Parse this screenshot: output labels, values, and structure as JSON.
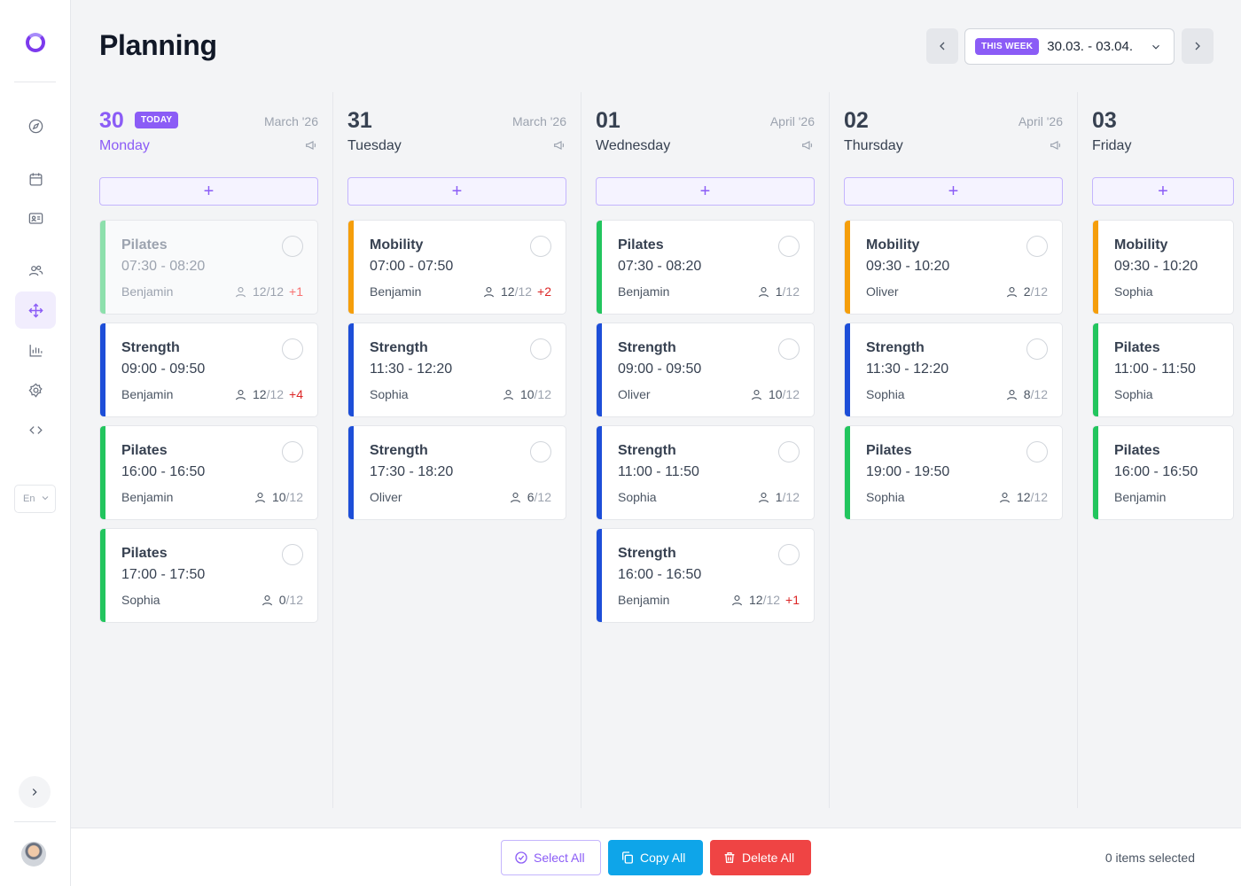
{
  "sidebar": {
    "nav_icons": [
      "compass-icon",
      "calendar-icon",
      "contact-card-icon",
      "users-icon",
      "move-arrows-icon",
      "bar-chart-icon",
      "gear-icon",
      "code-icon"
    ],
    "active_icon": "move-arrows-icon",
    "language": "En",
    "accent_color": "#8b5cf6"
  },
  "header": {
    "title": "Planning",
    "week_badge": "THIS WEEK",
    "week_range": "30.03. - 03.04."
  },
  "days": [
    {
      "num": "30",
      "weekday": "Monday",
      "month": "March '26",
      "today": true,
      "today_label": "TODAY",
      "classes": [
        {
          "title": "Pilates",
          "time": "07:30 - 08:20",
          "coach": "Benjamin",
          "booked": "12",
          "cap": "/12",
          "extra": "+1",
          "color": "#22c55e",
          "faded": true
        },
        {
          "title": "Strength",
          "time": "09:00 - 09:50",
          "coach": "Benjamin",
          "booked": "12",
          "cap": "/12",
          "extra": "+4",
          "color": "#1d4ed8",
          "faded": false
        },
        {
          "title": "Pilates",
          "time": "16:00 - 16:50",
          "coach": "Benjamin",
          "booked": "10",
          "cap": "/12",
          "extra": "",
          "color": "#22c55e",
          "faded": false
        },
        {
          "title": "Pilates",
          "time": "17:00 - 17:50",
          "coach": "Sophia",
          "booked": "0",
          "cap": "/12",
          "extra": "",
          "color": "#22c55e",
          "faded": false
        }
      ]
    },
    {
      "num": "31",
      "weekday": "Tuesday",
      "month": "March '26",
      "today": false,
      "classes": [
        {
          "title": "Mobility",
          "time": "07:00 - 07:50",
          "coach": "Benjamin",
          "booked": "12",
          "cap": "/12",
          "extra": "+2",
          "color": "#f59e0b",
          "faded": false
        },
        {
          "title": "Strength",
          "time": "11:30 - 12:20",
          "coach": "Sophia",
          "booked": "10",
          "cap": "/12",
          "extra": "",
          "color": "#1d4ed8",
          "faded": false
        },
        {
          "title": "Strength",
          "time": "17:30 - 18:20",
          "coach": "Oliver",
          "booked": "6",
          "cap": "/12",
          "extra": "",
          "color": "#1d4ed8",
          "faded": false
        }
      ]
    },
    {
      "num": "01",
      "weekday": "Wednesday",
      "month": "April '26",
      "today": false,
      "classes": [
        {
          "title": "Pilates",
          "time": "07:30 - 08:20",
          "coach": "Benjamin",
          "booked": "1",
          "cap": "/12",
          "extra": "",
          "color": "#22c55e",
          "faded": false
        },
        {
          "title": "Strength",
          "time": "09:00 - 09:50",
          "coach": "Oliver",
          "booked": "10",
          "cap": "/12",
          "extra": "",
          "color": "#1d4ed8",
          "faded": false
        },
        {
          "title": "Strength",
          "time": "11:00 - 11:50",
          "coach": "Sophia",
          "booked": "1",
          "cap": "/12",
          "extra": "",
          "color": "#1d4ed8",
          "faded": false
        },
        {
          "title": "Strength",
          "time": "16:00 - 16:50",
          "coach": "Benjamin",
          "booked": "12",
          "cap": "/12",
          "extra": "+1",
          "color": "#1d4ed8",
          "faded": false
        }
      ]
    },
    {
      "num": "02",
      "weekday": "Thursday",
      "month": "April '26",
      "today": false,
      "classes": [
        {
          "title": "Mobility",
          "time": "09:30 - 10:20",
          "coach": "Oliver",
          "booked": "2",
          "cap": "/12",
          "extra": "",
          "color": "#f59e0b",
          "faded": false
        },
        {
          "title": "Strength",
          "time": "11:30 - 12:20",
          "coach": "Sophia",
          "booked": "8",
          "cap": "/12",
          "extra": "",
          "color": "#1d4ed8",
          "faded": false
        },
        {
          "title": "Pilates",
          "time": "19:00 - 19:50",
          "coach": "Sophia",
          "booked": "12",
          "cap": "/12",
          "extra": "",
          "color": "#22c55e",
          "faded": false
        }
      ]
    },
    {
      "num": "03",
      "weekday": "Friday",
      "month": "",
      "today": false,
      "classes": [
        {
          "title": "Mobility",
          "time": "09:30 - 10:20",
          "coach": "Sophia",
          "booked": "",
          "cap": "",
          "extra": "",
          "color": "#f59e0b",
          "faded": false
        },
        {
          "title": "Pilates",
          "time": "11:00 - 11:50",
          "coach": "Sophia",
          "booked": "",
          "cap": "",
          "extra": "",
          "color": "#22c55e",
          "faded": false
        },
        {
          "title": "Pilates",
          "time": "16:00 - 16:50",
          "coach": "Benjamin",
          "booked": "",
          "cap": "",
          "extra": "",
          "color": "#22c55e",
          "faded": false
        }
      ]
    }
  ],
  "add_label": "+",
  "footer": {
    "select_all": "Select All",
    "copy_all": "Copy All",
    "delete_all": "Delete All",
    "selected_status": "0 items selected"
  }
}
